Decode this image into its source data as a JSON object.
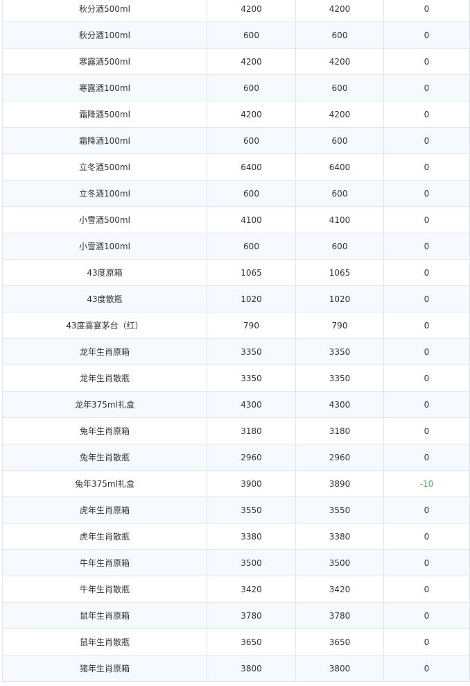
{
  "table": {
    "rows": [
      {
        "name": "秋分酒500ml",
        "col2": "4200",
        "col3": "4200",
        "change": "0"
      },
      {
        "name": "秋分酒100ml",
        "col2": "600",
        "col3": "600",
        "change": "0"
      },
      {
        "name": "寒露酒500ml",
        "col2": "4200",
        "col3": "4200",
        "change": "0"
      },
      {
        "name": "寒露酒100ml",
        "col2": "600",
        "col3": "600",
        "change": "0"
      },
      {
        "name": "霜降酒500ml",
        "col2": "4200",
        "col3": "4200",
        "change": "0"
      },
      {
        "name": "霜降酒100ml",
        "col2": "600",
        "col3": "600",
        "change": "0"
      },
      {
        "name": "立冬酒500ml",
        "col2": "6400",
        "col3": "6400",
        "change": "0"
      },
      {
        "name": "立冬酒100ml",
        "col2": "600",
        "col3": "600",
        "change": "0"
      },
      {
        "name": "小雪酒500ml",
        "col2": "4100",
        "col3": "4100",
        "change": "0"
      },
      {
        "name": "小雪酒100ml",
        "col2": "600",
        "col3": "600",
        "change": "0"
      },
      {
        "name": "43度原箱",
        "col2": "1065",
        "col3": "1065",
        "change": "0"
      },
      {
        "name": "43度散瓶",
        "col2": "1020",
        "col3": "1020",
        "change": "0"
      },
      {
        "name": "43度喜宴茅台（红）",
        "col2": "790",
        "col3": "790",
        "change": "0"
      },
      {
        "name": "龙年生肖原箱",
        "col2": "3350",
        "col3": "3350",
        "change": "0"
      },
      {
        "name": "龙年生肖散瓶",
        "col2": "3350",
        "col3": "3350",
        "change": "0"
      },
      {
        "name": "龙年375ml礼盒",
        "col2": "4300",
        "col3": "4300",
        "change": "0"
      },
      {
        "name": "兔年生肖原箱",
        "col2": "3180",
        "col3": "3180",
        "change": "0"
      },
      {
        "name": "兔年生肖散瓶",
        "col2": "2960",
        "col3": "2960",
        "change": "0"
      },
      {
        "name": "兔年375ml礼盒",
        "col2": "3900",
        "col3": "3890",
        "change": "-10"
      },
      {
        "name": "虎年生肖原箱",
        "col2": "3550",
        "col3": "3550",
        "change": "0"
      },
      {
        "name": "虎年生肖散瓶",
        "col2": "3380",
        "col3": "3380",
        "change": "0"
      },
      {
        "name": "牛年生肖原箱",
        "col2": "3500",
        "col3": "3500",
        "change": "0"
      },
      {
        "name": "牛年生肖散瓶",
        "col2": "3420",
        "col3": "3420",
        "change": "0"
      },
      {
        "name": "鼠年生肖原箱",
        "col2": "3780",
        "col3": "3780",
        "change": "0"
      },
      {
        "name": "鼠年生肖散瓶",
        "col2": "3650",
        "col3": "3650",
        "change": "0"
      },
      {
        "name": "猪年生肖原箱",
        "col2": "3800",
        "col3": "3800",
        "change": "0"
      }
    ]
  },
  "colors": {
    "negative_change": "#4caf50",
    "alt_row_bg": "#f6f9fe",
    "border": "#e2e5ea"
  }
}
